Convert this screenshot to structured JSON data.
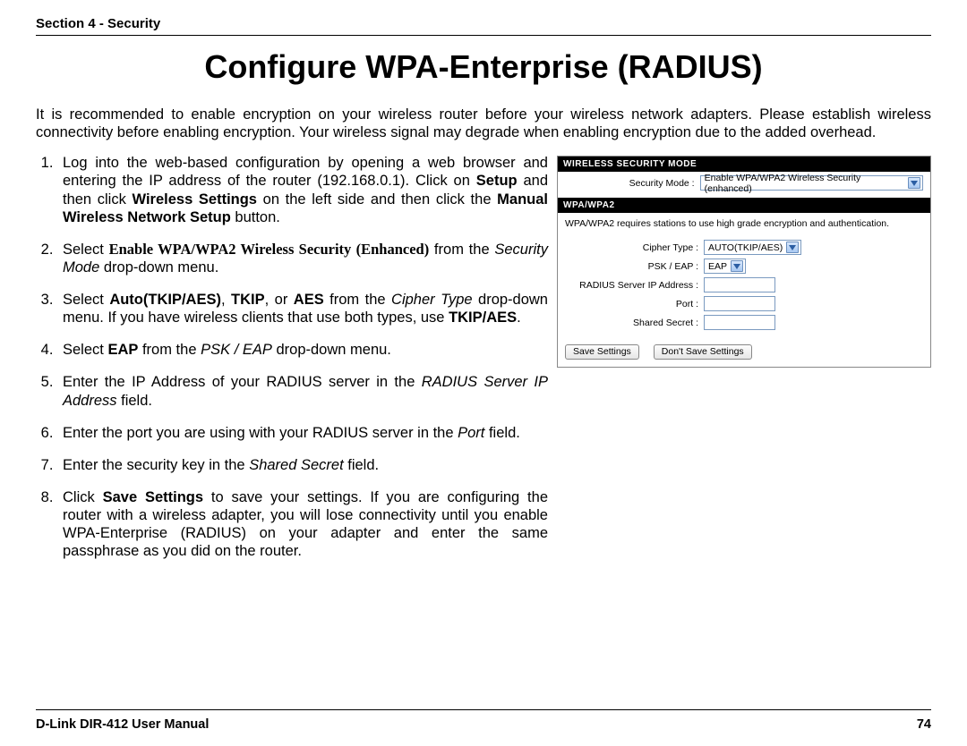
{
  "header": {
    "section": "Section 4 - Security"
  },
  "title": "Configure WPA-Enterprise (RADIUS)",
  "intro": "It is recommended to enable encryption on your wireless router before your wireless network adapters. Please establish wireless connectivity before enabling encryption. Your wireless signal may degrade when enabling encryption due to the added overhead.",
  "steps": {
    "s1a": "Log into the web-based configuration by opening a web browser and entering the IP address of the router (192.168.0.1). Click on ",
    "s1b_setup": "Setup",
    "s1c": " and then click ",
    "s1d_ws": "Wireless Settings",
    "s1e": " on the left side and then click the ",
    "s1f_mwns": "Manual Wireless Network Setup",
    "s1g": " button.",
    "s2a": "Select ",
    "s2b": "Enable WPA/WPA2 Wireless Security (Enhanced)",
    "s2c": " from the ",
    "s2d": "Security Mode",
    "s2e": " drop-down menu.",
    "s3a": "Select ",
    "s3b": "Auto(TKIP/AES)",
    "s3c": ", ",
    "s3d": "TKIP",
    "s3e": ", or ",
    "s3f": "AES",
    "s3g": " from the ",
    "s3h": "Cipher Type",
    "s3i": " drop-down menu. If you have wireless clients that use both types, use ",
    "s3j": "TKIP/AES",
    "s3k": ".",
    "s4a": "Select ",
    "s4b": "EAP",
    "s4c": " from the ",
    "s4d": "PSK / EAP",
    "s4e": " drop-down menu.",
    "s5a": "Enter the IP Address of your RADIUS server in the ",
    "s5b": "RADIUS Server IP Address",
    "s5c": " field.",
    "s6a": "Enter the port you are using with your RADIUS server in the ",
    "s6b": "Port",
    "s6c": " field.",
    "s7a": "Enter the security key in the ",
    "s7b": "Shared Secret",
    "s7c": " field.",
    "s8a": "Click ",
    "s8b": "Save Settings",
    "s8c": " to save your settings. If you are configuring the router with a wireless adapter, you will lose connectivity until you enable WPA-Enterprise (RADIUS) on your adapter and enter the same passphrase as you did on the router."
  },
  "panel": {
    "heading1": "WIRELESS SECURITY MODE",
    "security_mode_label": "Security Mode :",
    "security_mode_value": "Enable WPA/WPA2 Wireless Security (enhanced)",
    "heading2": "WPA/WPA2",
    "note": "WPA/WPA2 requires stations to use high grade encryption and authentication.",
    "cipher_label": "Cipher Type :",
    "cipher_value": "AUTO(TKIP/AES)",
    "psk_label": "PSK / EAP :",
    "psk_value": "EAP",
    "radius_label": "RADIUS Server IP Address :",
    "port_label": "Port :",
    "secret_label": "Shared Secret :",
    "save_btn": "Save Settings",
    "dont_save_btn": "Don't Save Settings"
  },
  "footer": {
    "left": "D-Link DIR-412 User Manual",
    "right": "74"
  }
}
